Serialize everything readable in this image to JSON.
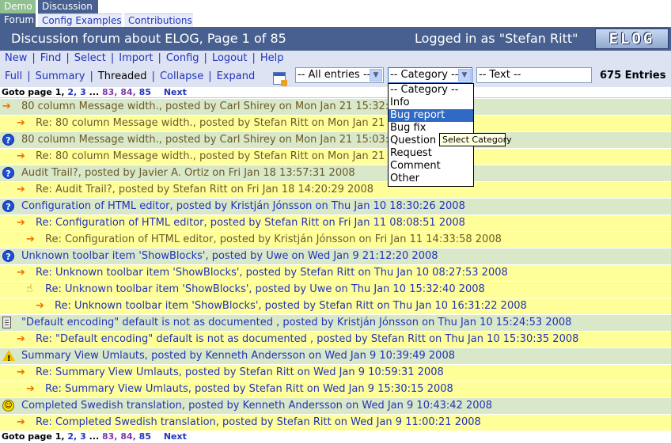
{
  "tabs_top": [
    {
      "label": "Demo"
    },
    {
      "label": "Discussion"
    }
  ],
  "tabs_sub": [
    {
      "label": "Forum"
    },
    {
      "label": "Config Examples"
    },
    {
      "label": "Contributions"
    }
  ],
  "header": {
    "title": "Discussion forum about ELOG, Page 1 of 85",
    "login": "Logged in as \"Stefan Ritt\"",
    "logo": "ELOG"
  },
  "menu": [
    "New",
    "Find",
    "Select",
    "Import",
    "Config",
    "Logout",
    "Help"
  ],
  "views": {
    "full": "Full",
    "summary": "Summary",
    "threaded": "Threaded",
    "collapse": "Collapse",
    "expand": "Expand"
  },
  "filters": {
    "entries_value": "-- All entries --",
    "category_value": "-- Category --",
    "text_value": "-- Text --",
    "count": "675 Entries"
  },
  "dropdown": {
    "options": [
      "-- Category --",
      "Info",
      "Bug report",
      "Bug fix",
      "Question",
      "Request",
      "Comment",
      "Other"
    ],
    "highlighted": "Bug report",
    "tooltip": "Select Category"
  },
  "goto": {
    "label": "Goto page",
    "p1": "1,",
    "p2": "2,",
    "p3": "3",
    "dots": "...",
    "p83": "83,",
    "p84": "84,",
    "p85": "85",
    "next": "Next"
  },
  "entries": [
    {
      "type": "thread",
      "icon": "arrow-icon",
      "indent": 0,
      "muted": true,
      "text": "80 column Message width., posted by Carl Shirey on Mon Jan 21 15:32:0"
    },
    {
      "type": "reply",
      "icon": "arrow-icon",
      "indent": 1,
      "muted": true,
      "text": "Re: 80 column Message width., posted by Stefan Ritt on Mon Jan 21 15"
    },
    {
      "type": "thread",
      "icon": "question-icon",
      "indent": 0,
      "muted": true,
      "text": "80 column Message width., posted by Carl Shirey on Mon Jan 21 15:03:4"
    },
    {
      "type": "reply",
      "icon": "arrow-icon",
      "indent": 1,
      "muted": true,
      "text": "Re: 80 column Message width., posted by Stefan Ritt on Mon Jan 21 15"
    },
    {
      "type": "thread",
      "icon": "question-icon",
      "indent": 0,
      "muted": true,
      "text": "Audit Trail?, posted by Javier A. Ortiz on Fri Jan 18 13:57:31 2008"
    },
    {
      "type": "reply",
      "icon": "arrow-icon",
      "indent": 1,
      "muted": true,
      "text": "Re: Audit Trail?, posted by Stefan Ritt on Fri Jan 18 14:20:29 2008"
    },
    {
      "type": "thread",
      "icon": "question-icon",
      "indent": 0,
      "muted": false,
      "text": "Configuration of HTML editor, posted by Kristján Jónsson on Thu Jan 10 18:30:26 2008"
    },
    {
      "type": "reply",
      "icon": "arrow-icon",
      "indent": 1,
      "muted": false,
      "text": "Re: Configuration of HTML editor, posted by Stefan Ritt on Fri Jan 11 08:08:51 2008"
    },
    {
      "type": "reply",
      "icon": "arrow-icon",
      "indent": 2,
      "muted": true,
      "text": "Re: Configuration of HTML editor, posted by Kristján Jónsson on Fri Jan 11 14:33:58 2008"
    },
    {
      "type": "thread",
      "icon": "question-icon",
      "indent": 0,
      "muted": false,
      "text": "Unknown toolbar item 'ShowBlocks', posted by Uwe on Wed Jan 9 21:12:20 2008"
    },
    {
      "type": "reply",
      "icon": "arrow-icon",
      "indent": 1,
      "muted": false,
      "text": "Re: Unknown toolbar item 'ShowBlocks', posted by Stefan Ritt on Thu Jan 10 08:27:53 2008"
    },
    {
      "type": "reply",
      "icon": "thumb-icon",
      "indent": 2,
      "muted": false,
      "text": "Re: Unknown toolbar item 'ShowBlocks', posted by Uwe on Thu Jan 10 15:32:40 2008"
    },
    {
      "type": "reply",
      "icon": "arrow-icon",
      "indent": 3,
      "muted": false,
      "text": "Re: Unknown toolbar item 'ShowBlocks', posted by Stefan Ritt on Thu Jan 10 16:31:22 2008"
    },
    {
      "type": "thread",
      "icon": "document-icon",
      "indent": 0,
      "muted": false,
      "text": "\"Default encoding\" default is not as documented , posted by Kristján Jónsson on Thu Jan 10 15:24:53 2008"
    },
    {
      "type": "reply",
      "icon": "arrow-icon",
      "indent": 1,
      "muted": false,
      "text": "Re: \"Default encoding\" default is not as documented , posted by Stefan Ritt on Thu Jan 10 15:30:35 2008"
    },
    {
      "type": "thread",
      "icon": "warning-icon",
      "indent": 0,
      "muted": false,
      "text": "Summary View Umlauts, posted by Kenneth Andersson on Wed Jan 9 10:39:49 2008"
    },
    {
      "type": "reply",
      "icon": "arrow-icon",
      "indent": 1,
      "muted": false,
      "text": "Re: Summary View Umlauts, posted by Stefan Ritt on Wed Jan 9 10:59:31 2008"
    },
    {
      "type": "reply",
      "icon": "arrow-icon",
      "indent": 2,
      "muted": false,
      "text": "Re: Summary View Umlauts, posted by Stefan Ritt on Wed Jan 9 15:30:15 2008"
    },
    {
      "type": "thread",
      "icon": "smiley-icon",
      "indent": 0,
      "muted": false,
      "text": "Completed Swedish translation, posted by Kenneth Andersson on Wed Jan 9 10:43:42 2008"
    },
    {
      "type": "reply",
      "icon": "arrow-icon",
      "indent": 1,
      "muted": false,
      "text": "Re: Completed Swedish translation, posted by Stefan Ritt on Wed Jan 9 11:00:21 2008"
    }
  ]
}
